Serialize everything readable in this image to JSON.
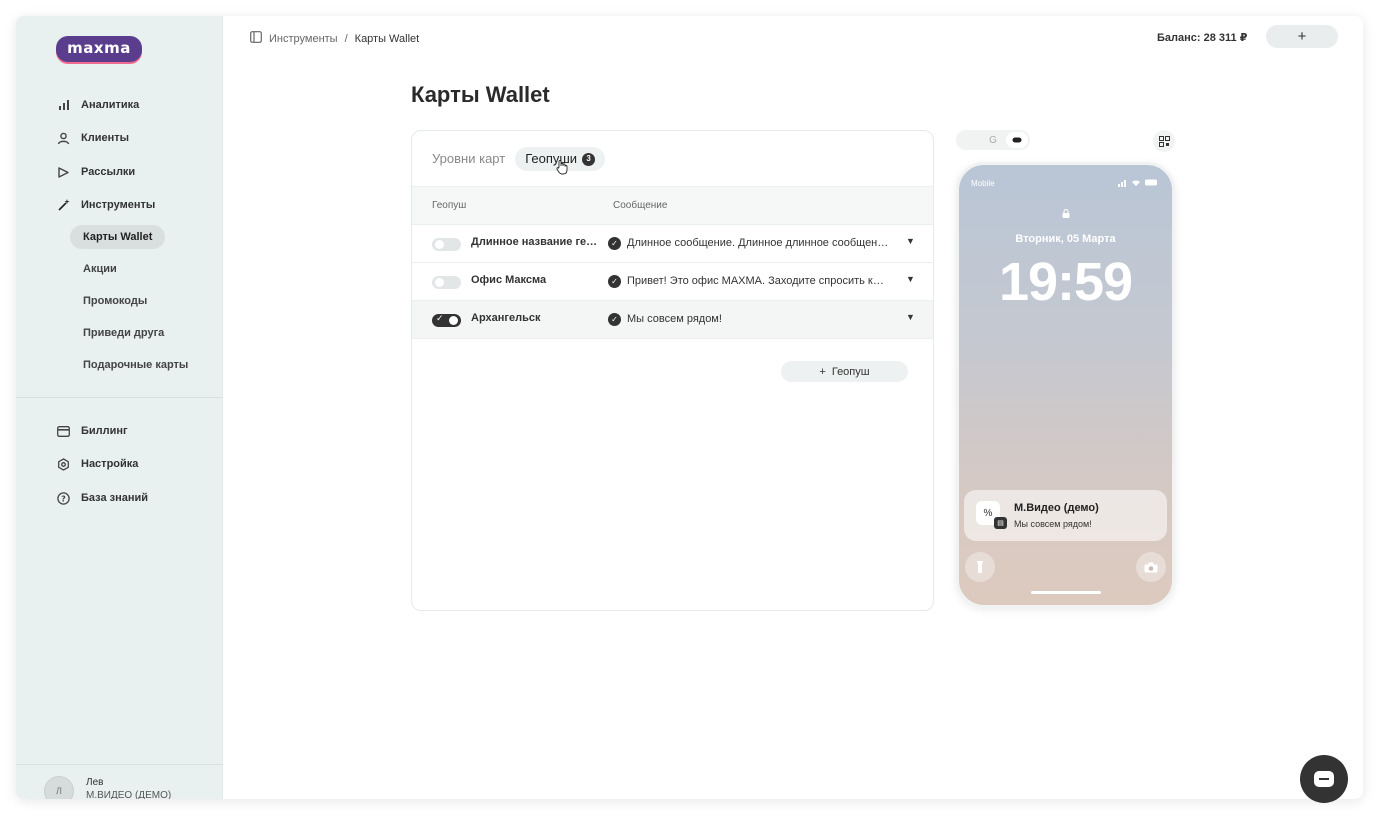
{
  "app": {
    "logo": "maxma"
  },
  "sidebar": {
    "items": [
      {
        "label": "Аналитика",
        "icon": "bar-chart-icon"
      },
      {
        "label": "Клиенты",
        "icon": "user-icon"
      },
      {
        "label": "Рассылки",
        "icon": "send-icon"
      },
      {
        "label": "Инструменты",
        "icon": "magic-wand-icon"
      }
    ],
    "subitems": [
      {
        "label": "Карты Wallet",
        "active": true
      },
      {
        "label": "Акции"
      },
      {
        "label": "Промокоды"
      },
      {
        "label": "Приведи друга"
      },
      {
        "label": "Подарочные карты"
      }
    ],
    "bottom_items": [
      {
        "label": "Биллинг",
        "icon": "card-icon"
      },
      {
        "label": "Настройка",
        "icon": "settings-icon"
      },
      {
        "label": "База знаний",
        "icon": "help-icon"
      }
    ],
    "user": {
      "name": "Лев",
      "company": "М.ВИДЕО (ДЕМО)"
    }
  },
  "header": {
    "breadcrumb": {
      "parent": "Инструменты",
      "separator": "/",
      "current": "Карты Wallet"
    },
    "balance": "Баланс: 28 311 ₽",
    "add_label": "+"
  },
  "main": {
    "title": "Карты Wallet",
    "tabs": [
      {
        "label": "Уровни карт"
      },
      {
        "label": "Геопуши",
        "count": "3",
        "active": true
      }
    ],
    "table": {
      "columns": [
        "Геопуш",
        "Сообщение"
      ],
      "rows": [
        {
          "name": "Длинное название геопуша",
          "message": "Длинное сообщение. Длинное длинное сообщение",
          "enabled": false
        },
        {
          "name": "Офис Максма",
          "message": "Привет! Это офис MAXMA. Заходите спросить кофе",
          "enabled": false
        },
        {
          "name": "Архангельск",
          "message": "Мы совсем рядом!",
          "enabled": true
        }
      ]
    },
    "add_button": "Геопуш"
  },
  "preview": {
    "platforms": [
      "apple-icon",
      "google-icon",
      "pill-icon"
    ],
    "carrier": "Mobile",
    "date": "Вторник, 05 Марта",
    "time": "19:59",
    "notification": {
      "title": "М.Видео (демо)",
      "message": "Мы совсем рядом!"
    }
  },
  "colors": {
    "accent": "#333333",
    "sidebar_bg": "#e8f0f0",
    "logo_bg": "#5a3d8c"
  }
}
